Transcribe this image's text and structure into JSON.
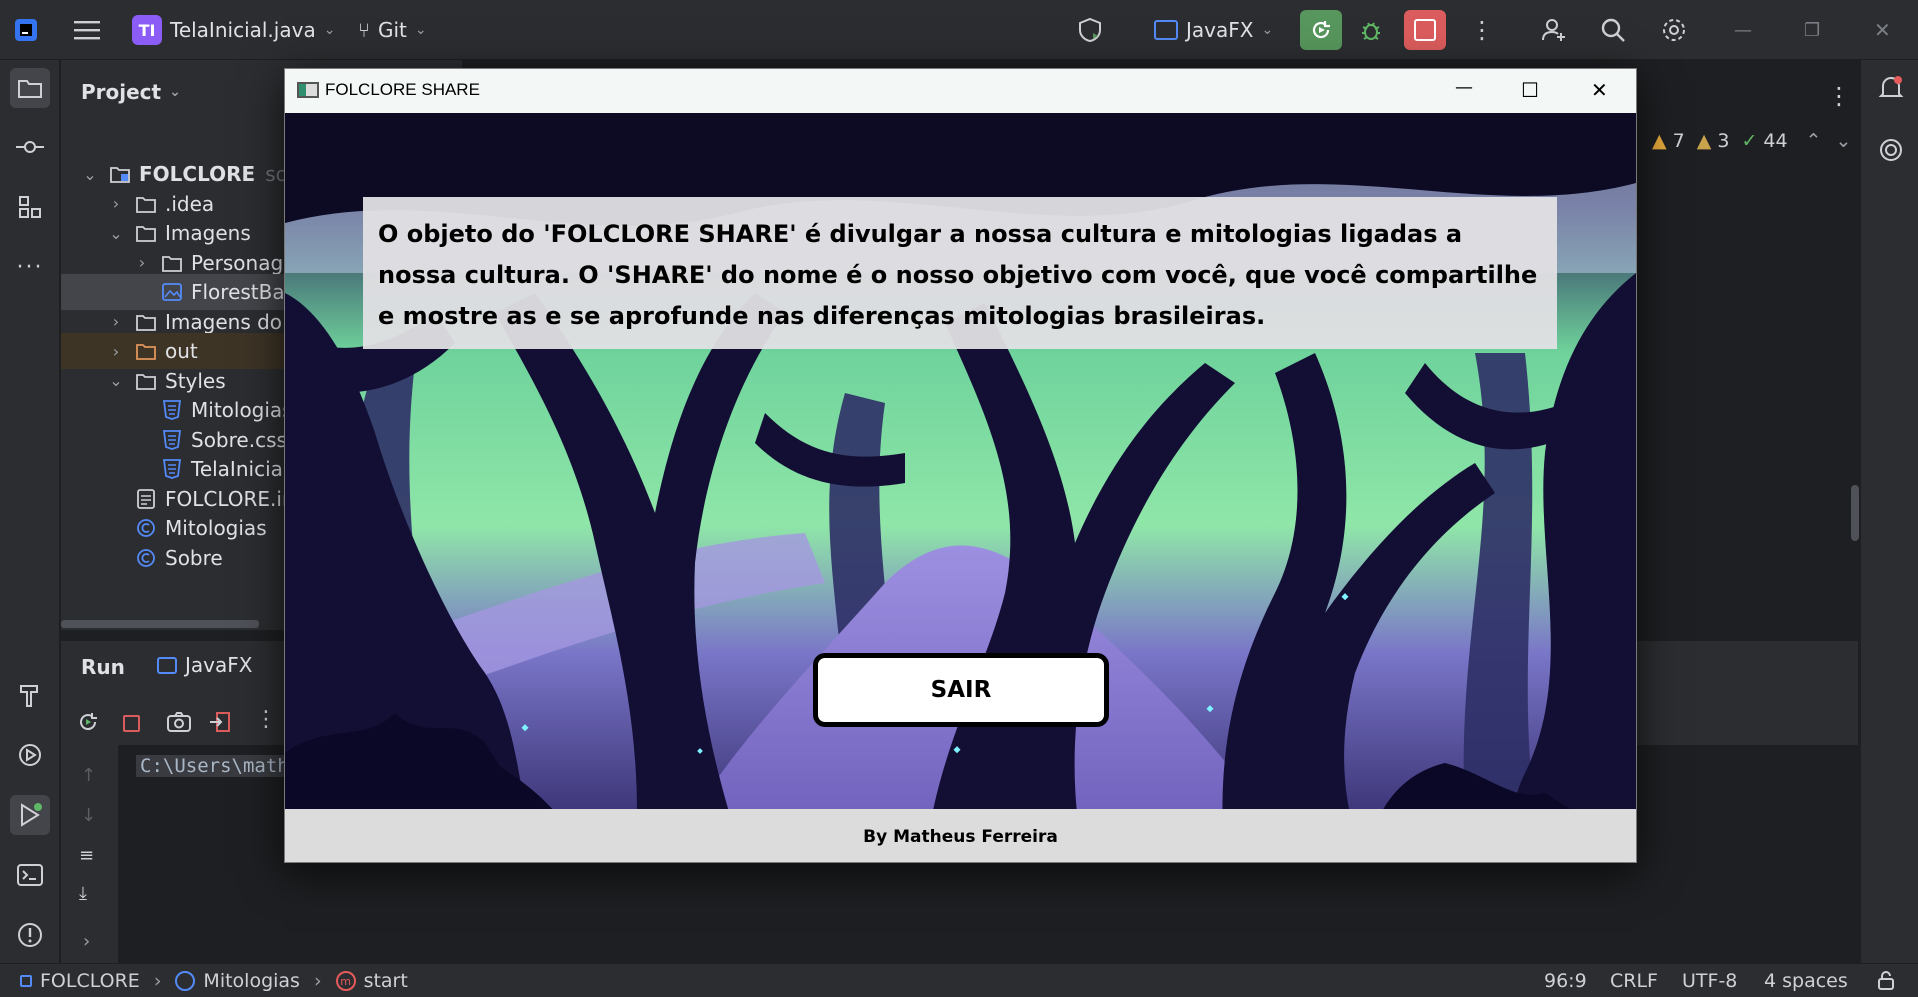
{
  "ide": {
    "project_badge": "TI",
    "project_file": "TelaInicial.java",
    "vcs": "Git",
    "run_config": "JavaFX",
    "panel_title": "Project",
    "inspections": {
      "warnings": "7",
      "weak_warnings": "3",
      "ok": "44"
    },
    "tree": [
      {
        "label": "FOLCLORE",
        "suffix": "sou",
        "chev": "v",
        "icon": "module"
      },
      {
        "label": ".idea",
        "chev": ">",
        "icon": "folder"
      },
      {
        "label": "Imagens",
        "chev": "v",
        "icon": "folder"
      },
      {
        "label": "Personag",
        "chev": ">",
        "icon": "folder"
      },
      {
        "label": "FlorestBa",
        "chev": "",
        "icon": "image"
      },
      {
        "label": "Imagens do F",
        "chev": ">",
        "icon": "folder"
      },
      {
        "label": "out",
        "chev": ">",
        "icon": "folder-orange"
      },
      {
        "label": "Styles",
        "chev": "v",
        "icon": "folder"
      },
      {
        "label": "Mitologias",
        "chev": "",
        "icon": "css"
      },
      {
        "label": "Sobre.css",
        "chev": "",
        "icon": "css"
      },
      {
        "label": "TelaInicia",
        "chev": "",
        "icon": "css"
      },
      {
        "label": "FOLCLORE.ir",
        "chev": "",
        "icon": "file"
      },
      {
        "label": "Mitologias",
        "chev": "",
        "icon": "class"
      },
      {
        "label": "Sobre",
        "chev": "",
        "icon": "class"
      }
    ],
    "run_panel": {
      "title": "Run",
      "tab": "JavaFX",
      "console_line": "C:\\Users\\math"
    },
    "breadcrumb": [
      "FOLCLORE",
      "Mitologias",
      "start"
    ],
    "status": {
      "position": "96:9",
      "line_sep": "CRLF",
      "encoding": "UTF-8",
      "indent": "4 spaces"
    },
    "window_controls": {
      "minimize": "—",
      "restore": "❐",
      "close": "✕"
    }
  },
  "app": {
    "title": "FOLCLORE SHARE",
    "description": "O objeto do 'FOLCLORE SHARE' é divulgar a nossa cultura e mitologias ligadas a nossa cultura. O 'SHARE' do nome é o nosso objetivo com você, que você compartilhe e mostre as e se aprofunde nas diferenças mitologias brasileiras.",
    "button_label": "SAIR",
    "footer": "By Matheus Ferreira",
    "controls": {
      "minimize": "—",
      "maximize": "☐",
      "close": "✕"
    }
  },
  "colors": {
    "ide_bg": "#1e1f22",
    "ide_panel": "#2b2d30",
    "run_green": "#57965c",
    "stop_red": "#db5c5c",
    "forest_dark": "#0d0a24",
    "forest_green": "#7be3a5",
    "forest_purple": "#8a7cd0"
  }
}
